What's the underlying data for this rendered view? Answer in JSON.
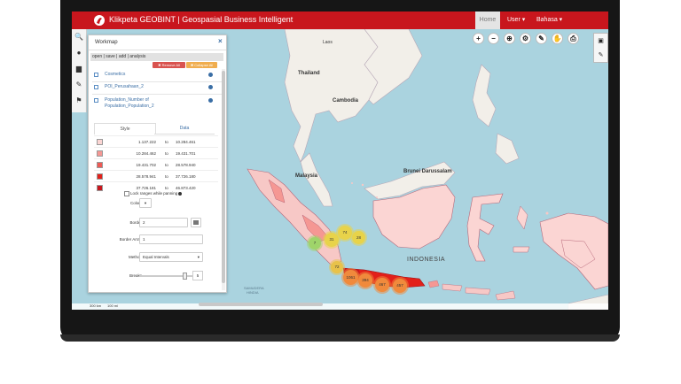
{
  "app": {
    "title": "Klikpeta GEOBINT | Geospasial Business Intelligent",
    "nav": {
      "home": "Home",
      "user": "User ▾",
      "bahasa": "Bahasa ▾"
    },
    "brand_color": "#c8161d"
  },
  "left_tools": [
    {
      "icon": "search-icon",
      "glyph": "🔍"
    },
    {
      "icon": "map-marker-icon",
      "glyph": "●"
    },
    {
      "icon": "building-icon",
      "glyph": "▆"
    },
    {
      "icon": "brush-icon",
      "glyph": "✎"
    },
    {
      "icon": "flag-icon",
      "glyph": "⚑"
    }
  ],
  "workmap": {
    "title": "Workmap",
    "close": "×",
    "menu": "open | save | add | analysis",
    "remove_all": "✖ Remove All",
    "collapse_all": "✖ Collapse All",
    "layers": [
      {
        "name": "Cosmetics"
      },
      {
        "name": "POI_Perusahaan_2"
      },
      {
        "name": "Population_Number of"
      },
      {
        "name": "Population_Population_2"
      }
    ],
    "tabs": {
      "style": "Style",
      "data": "Data"
    },
    "legend": [
      {
        "from": "1.137.222",
        "to_label": "to",
        "to": "10.284.461",
        "color": "#fbd5d3"
      },
      {
        "from": "10.284.462",
        "to_label": "to",
        "to": "19.431.701",
        "color": "#f59793"
      },
      {
        "from": "19.431.702",
        "to_label": "to",
        "to": "28.578.940",
        "color": "#ee5a54"
      },
      {
        "from": "28.578.941",
        "to_label": "to",
        "to": "37.726.180",
        "color": "#e2201a"
      },
      {
        "from": "37.726.181",
        "to_label": "to",
        "to": "46.873.420",
        "color": "#c8161d"
      }
    ],
    "lock_label": "Lock ranges while panning",
    "fields": {
      "colors_label": "Colors",
      "colors_value": "▾",
      "border_label": "Border",
      "border_value": "2",
      "border_array_label": "Border Array",
      "border_array_value": "1",
      "method_label": "Method",
      "method_value": "Equal Intervals",
      "method_caret": "▾",
      "breaks_label": "Breaks",
      "breaks_value": "5"
    }
  },
  "map_tools": [
    {
      "icon": "zoom-in-icon",
      "glyph": "+"
    },
    {
      "icon": "zoom-out-icon",
      "glyph": "−"
    },
    {
      "icon": "locate-icon",
      "glyph": "⊕"
    },
    {
      "icon": "settings-icon",
      "glyph": "⚙"
    },
    {
      "icon": "draw-icon",
      "glyph": "✎"
    },
    {
      "icon": "hand-icon",
      "glyph": "✋"
    },
    {
      "icon": "print-icon",
      "glyph": "⎙"
    }
  ],
  "map_labels": {
    "laos": "Laos",
    "thailand": "Thailand",
    "cambodia": "Cambodia",
    "malaysia": "Malaysia",
    "brunei": "Brunei Darussalam",
    "indonesia": "INDONESIA",
    "samudera": "SAMUDERA",
    "hindia": "HINDIA"
  },
  "clusters": [
    {
      "value": "7",
      "color": "#9fd46a"
    },
    {
      "value": "31",
      "color": "#e8d34a"
    },
    {
      "value": "74",
      "color": "#e8d34a"
    },
    {
      "value": "28",
      "color": "#e8d34a"
    },
    {
      "value": "72",
      "color": "#e8c24a"
    },
    {
      "value": "1061",
      "color": "#f08a3c"
    },
    {
      "value": "394",
      "color": "#f08a3c"
    },
    {
      "value": "467",
      "color": "#f08a3c"
    },
    {
      "value": "457",
      "color": "#f08a3c"
    }
  ],
  "scale": {
    "km": "300 km",
    "mi": "100 mi"
  }
}
